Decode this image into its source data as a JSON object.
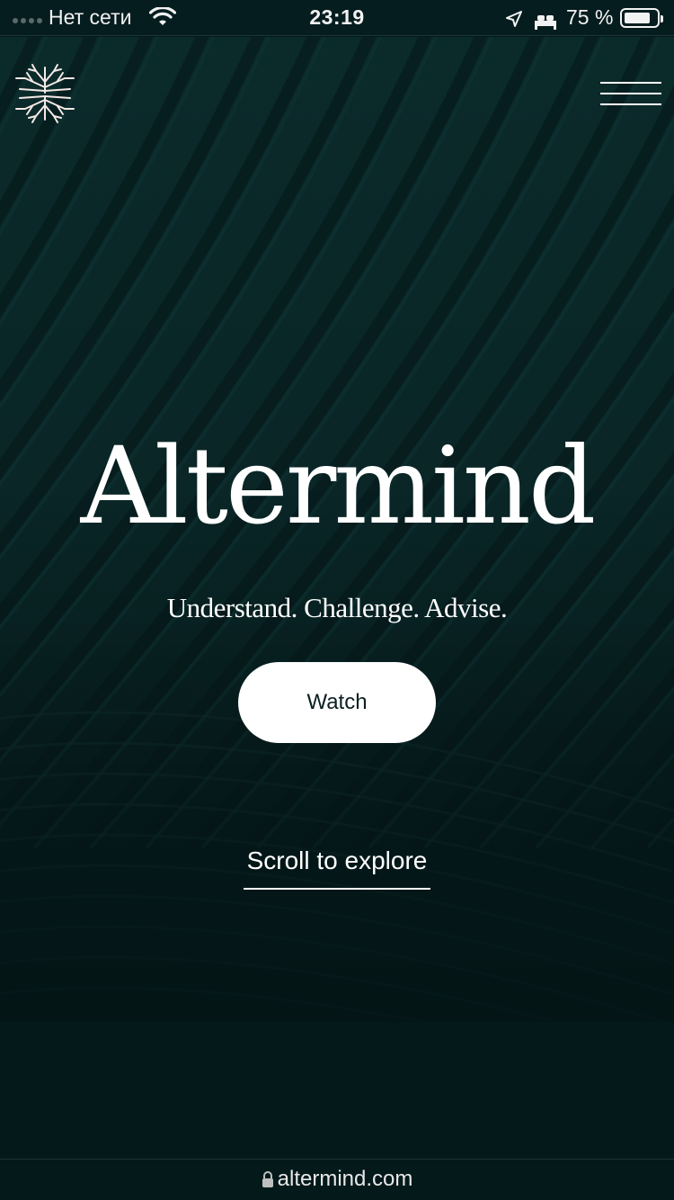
{
  "status_bar": {
    "carrier": "Нет сети",
    "time": "23:19",
    "battery": "75 %",
    "battery_level": 0.75,
    "icons": [
      "signal-icon",
      "wifi-icon",
      "location-icon",
      "sleep-bed-icon",
      "battery-icon"
    ]
  },
  "header": {
    "logo_icon": "tree-roots-logo-icon",
    "menu_icon": "hamburger-menu-icon"
  },
  "hero": {
    "title": "Altermind",
    "tagline": "Understand. Challenge. Advise.",
    "watch_label": "Watch",
    "scroll_label": "Scroll to explore"
  },
  "browser": {
    "url": "altermind.com",
    "lock_icon": "lock-icon"
  },
  "colors": {
    "background": "#03191a",
    "hero_dark_green": "#0a2627",
    "button_bg": "#ffffff",
    "text": "#ffffff"
  }
}
